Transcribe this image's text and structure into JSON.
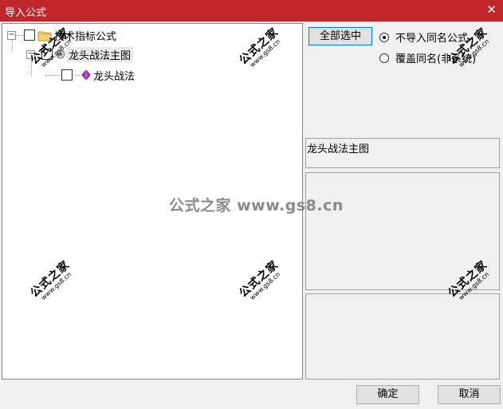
{
  "window": {
    "title": "导入公式",
    "close_glyph": "✕"
  },
  "tree": {
    "root_label": "技术指标公式",
    "child_label": "龙头战法主图",
    "grandchild_label": "龙头战法",
    "expander_glyph": "−"
  },
  "controls": {
    "select_all_label": "全部选中",
    "radio_skip_label": "不导入同名公式",
    "radio_overwrite_label": "覆盖同名(非系统)",
    "selected_radio": "skip"
  },
  "info": {
    "formula_name": "龙头战法主图"
  },
  "footer": {
    "ok_label": "确定",
    "cancel_label": "取消"
  },
  "watermark": {
    "center_text": "公式之家 www.gs8.cn",
    "stamp_text": "公式之家",
    "stamp_url": "www.gs8.cn"
  },
  "colors": {
    "titlebar": "#c0262a",
    "dialog_bg": "#f0f0f0",
    "focus_border": "#0078d7"
  }
}
